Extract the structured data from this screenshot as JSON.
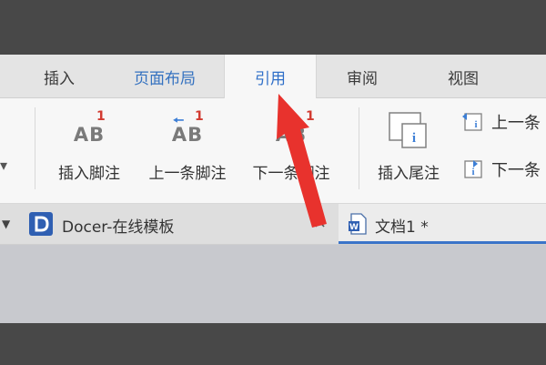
{
  "menu_tabs": [
    "插入",
    "页面布局",
    "引用",
    "审阅",
    "视图"
  ],
  "ribbon": {
    "footnote_superscript": "1",
    "ab_glyph": "AB",
    "insert_footnote": "插入脚注",
    "prev_footnote": "上一条脚注",
    "next_footnote": "下一条脚注",
    "insert_endnote": "插入尾注",
    "prev_note": "上一条",
    "next_note": "下一条"
  },
  "documents": {
    "docer_tab": "Docer-在线模板",
    "doc_tab": "文档1 *",
    "close_symbol": "×"
  },
  "colors": {
    "accent": "#2f6fc8",
    "pointer_arrow": "#e8322d",
    "superscript": "#d23a30"
  }
}
